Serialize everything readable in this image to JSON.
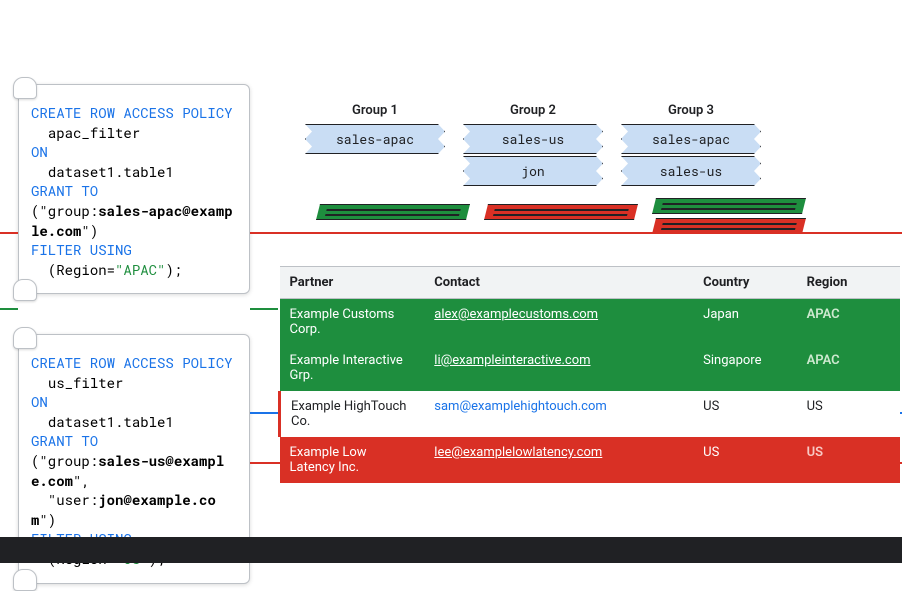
{
  "groups": [
    {
      "title": "Group 1",
      "flags": [
        "sales-apac"
      ]
    },
    {
      "title": "Group 2",
      "flags": [
        "sales-us",
        "jon"
      ]
    },
    {
      "title": "Group 3",
      "flags": [
        "sales-apac",
        "sales-us"
      ]
    }
  ],
  "policies": {
    "apac": {
      "create": "CREATE ROW ACCESS POLICY",
      "name": "apac_filter",
      "on": "ON",
      "target": "dataset1.table1",
      "grant": "GRANT TO",
      "grant_open": "(\"group:",
      "grant_principal": "sales-apac@example.com",
      "grant_close": "\")",
      "filter": "FILTER USING",
      "filter_expr_open": "  (Region=",
      "filter_value": "\"APAC\"",
      "filter_expr_close": ");"
    },
    "us": {
      "create": "CREATE ROW ACCESS POLICY",
      "name": "us_filter",
      "on": "ON",
      "target": "dataset1.table1",
      "grant": "GRANT TO",
      "grant_line1_open": "(\"group:",
      "grant_line1_principal": "sales-us@example.com",
      "grant_line1_close": "\",",
      "grant_line2_open": "  \"user:",
      "grant_line2_principal": "jon@example.com",
      "grant_line2_close": "\")",
      "filter": "FILTER USING",
      "filter_expr_open": "  (Region=",
      "filter_value": "\"US\"",
      "filter_expr_close": ");"
    }
  },
  "table": {
    "headers": {
      "partner": "Partner",
      "contact": "Contact",
      "country": "Country",
      "region": "Region"
    },
    "rows": [
      {
        "partner": "Example Customs Corp.",
        "contact": "alex@examplecustoms.com",
        "country": "Japan",
        "region": "APAC",
        "region_class": "apac"
      },
      {
        "partner": "Example Interactive Grp.",
        "contact": "li@exampleinteractive.com",
        "country": "Singapore",
        "region": "APAC",
        "region_class": "apac"
      },
      {
        "partner": "Example HighTouch Co.",
        "contact": "sam@examplehightouch.com",
        "country": "US",
        "region": "US",
        "region_class": "plain"
      },
      {
        "partner": "Example Low Latency Inc.",
        "contact": "lee@examplelowlatency.com",
        "country": "US",
        "region": "US",
        "region_class": "us"
      }
    ]
  },
  "colors": {
    "green": "#1e8e3e",
    "red": "#d93025",
    "blue": "#1a73e8",
    "flag": "#c9ddf4"
  }
}
